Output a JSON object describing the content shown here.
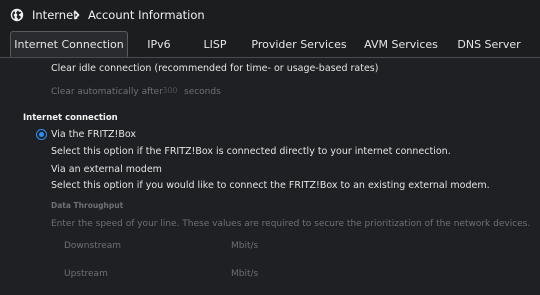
{
  "breadcrumb": {
    "section": "Internet",
    "page": "Account Information"
  },
  "tabs": [
    {
      "label": "Internet Connection",
      "active": true
    },
    {
      "label": "IPv6",
      "active": false
    },
    {
      "label": "LISP",
      "active": false
    },
    {
      "label": "Provider Services",
      "active": false
    },
    {
      "label": "AVM Services",
      "active": false
    },
    {
      "label": "DNS Server",
      "active": false
    }
  ],
  "idle": {
    "option_label": "Clear idle connection (recommended for time- or usage-based rates)",
    "auto_prefix": "Clear automatically after",
    "auto_value": "300",
    "auto_suffix": "seconds"
  },
  "internet_connection": {
    "heading": "Internet connection",
    "via_fritzbox": {
      "label": "Via the FRITZ!Box",
      "description": "Select this option if the FRITZ!Box is connected directly to your internet connection.",
      "selected": true
    },
    "via_modem": {
      "label": "Via an external modem",
      "description": "Select this option if you would like to connect the FRITZ!Box to an existing external modem.",
      "selected": false
    }
  },
  "throughput": {
    "heading": "Data Throughput",
    "description": "Enter the speed of your line. These values are required to secure the prioritization of the network devices.",
    "downstream_label": "Downstream",
    "downstream_unit": "Mbit/s",
    "upstream_label": "Upstream",
    "upstream_unit": "Mbit/s"
  },
  "colors": {
    "accent": "#2f8ef0",
    "background": "#1f2023",
    "text": "#e4e4e4",
    "disabled_text": "#6f7074"
  }
}
